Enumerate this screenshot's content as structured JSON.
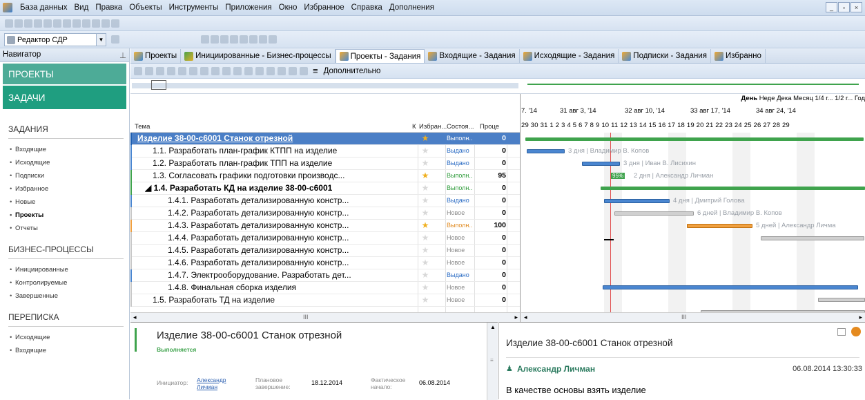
{
  "menu": [
    "База данных",
    "Вид",
    "Правка",
    "Объекты",
    "Инструменты",
    "Приложения",
    "Окно",
    "Избранное",
    "Справка",
    "Дополнения"
  ],
  "window_buttons": [
    "_",
    "▫",
    "×"
  ],
  "editor": {
    "label": "Редактор СДР"
  },
  "navigator": {
    "title": "Навигатор",
    "pin": "⊥",
    "big_items": [
      "ПРОЕКТЫ",
      "ЗАДАЧИ"
    ],
    "sections": [
      {
        "title": "ЗАДАНИЯ",
        "items": [
          "Входящие",
          "Исходящие",
          "Подписки",
          "Избранное",
          "Новые",
          "Проекты",
          "Отчеты"
        ],
        "bold_index": 5
      },
      {
        "title": "БИЗНЕС-ПРОЦЕССЫ",
        "items": [
          "Инициированные",
          "Контролируемые",
          "Завершенные"
        ]
      },
      {
        "title": "ПЕРЕПИСКА",
        "items": [
          "Исходящие",
          "Входящие"
        ]
      }
    ]
  },
  "tabs": [
    {
      "label": "Проекты",
      "icon": "projects-icon"
    },
    {
      "label": "Инициированные - Бизнес-процессы",
      "icon": "business-process-icon"
    },
    {
      "label": "Проекты - Задания",
      "icon": "tasks-icon",
      "selected": true
    },
    {
      "label": "Входящие - Задания",
      "icon": "tasks-icon"
    },
    {
      "label": "Исходящие - Задания",
      "icon": "tasks-icon"
    },
    {
      "label": "Подписки - Задания",
      "icon": "tasks-icon"
    },
    {
      "label": "Избранно",
      "icon": "tasks-icon"
    }
  ],
  "toolbar3": {
    "more_label": "Дополнительно",
    "more_icon": "hamburger-icon"
  },
  "grid": {
    "headers": {
      "topic": "Тема",
      "k": "К",
      "fav": "Избран...",
      "status": "Состоя...",
      "progress": "Проце"
    },
    "rows": [
      {
        "indent": 0,
        "text": "Изделие 38-00-с6001 Станок отрезной",
        "bold": true,
        "selected": true,
        "fav": true,
        "status": "Выполн...",
        "status_color": "white",
        "progress": "0",
        "bar": "#1f5fb0"
      },
      {
        "indent": 1,
        "text": "1.1. Разработать план-график КТПП на изделие",
        "bold": false,
        "fav": false,
        "status": "Выдано",
        "status_color": "blue",
        "progress": "0",
        "bar": "#4a86d0"
      },
      {
        "indent": 1,
        "text": "1.2. Разработать план-график ТПП на изделие",
        "bold": false,
        "fav": false,
        "status": "Выдано",
        "status_color": "blue",
        "progress": "0",
        "bar": "#4a86d0"
      },
      {
        "indent": 1,
        "text": "1.3. Согласовать графики подготовки производс...",
        "bold": false,
        "fav": true,
        "status": "Выполн...",
        "status_color": "green",
        "progress": "95",
        "bar": "#3fa34d"
      },
      {
        "indent": 0.5,
        "text": "◢ 1.4. Разработать КД на изделие 38-00-с6001",
        "bold": true,
        "fav": false,
        "status": "Выполн...",
        "status_color": "green",
        "progress": "0",
        "bar": "#3fa34d"
      },
      {
        "indent": 2,
        "text": "1.4.1. Разработать детализированную констр...",
        "bold": false,
        "fav": false,
        "status": "Выдано",
        "status_color": "blue",
        "progress": "0",
        "bar": "#4a86d0"
      },
      {
        "indent": 2,
        "text": "1.4.2. Разработать детализированную констр...",
        "bold": false,
        "fav": false,
        "status": "Новое",
        "status_color": "gray",
        "progress": "0",
        "bar": "#c8c8c8"
      },
      {
        "indent": 2,
        "text": "1.4.3. Разработать детализированную констр...",
        "bold": false,
        "fav": true,
        "status": "Выполн...",
        "status_color": "orange",
        "progress": "100",
        "bar": "#f0a040"
      },
      {
        "indent": 2,
        "text": "1.4.4. Разработать детализированную констр...",
        "bold": false,
        "fav": false,
        "status": "Новое",
        "status_color": "gray",
        "progress": "0",
        "bar": "#c8c8c8"
      },
      {
        "indent": 2,
        "text": "1.4.5. Разработать детализированную констр...",
        "bold": false,
        "fav": false,
        "status": "Новое",
        "status_color": "gray",
        "progress": "0",
        "bar": "#c8c8c8"
      },
      {
        "indent": 2,
        "text": "1.4.6. Разработать детализированную констр...",
        "bold": false,
        "fav": false,
        "status": "Новое",
        "status_color": "gray",
        "progress": "0",
        "bar": "#c8c8c8"
      },
      {
        "indent": 2,
        "text": "1.4.7. Электрооборудование. Разработать дет...",
        "bold": false,
        "fav": false,
        "status": "Выдано",
        "status_color": "blue",
        "progress": "0",
        "bar": "#4a86d0"
      },
      {
        "indent": 2,
        "text": "1.4.8. Финальная сборка изделия",
        "bold": false,
        "fav": false,
        "status": "Новое",
        "status_color": "gray",
        "progress": "0",
        "bar": "#c8c8c8"
      },
      {
        "indent": 1,
        "text": "1.5. Разработать ТД на изделие",
        "bold": false,
        "fav": false,
        "status": "Новое",
        "status_color": "gray",
        "progress": "0",
        "bar": "#c8c8c8"
      }
    ]
  },
  "gantt": {
    "view_switch": [
      "День",
      "Неде",
      "Дека",
      "Месяц",
      "1/4 г...",
      "1/2 г...",
      "Год"
    ],
    "weeks": [
      "7. '14",
      "31 авг 3, '14",
      "32 авг 10, '14",
      "33 авг 17, '14",
      "34 авг 24, '14"
    ],
    "days": "29 30 31  1  2  3  4  5  6  7  8  9 10 11 12 13 14 15 16 17 18 19 20 21 22 23 24 25 26 27 28 29",
    "labels": [
      "3 дня | Владимир В. Копов",
      "3 дня | Иван В. Лисихин",
      "95%",
      "2 дня | Александр Личман",
      "4 дня | Дмитрий Голова",
      "6 дней | Владимир В. Копов",
      "5 дней | Александр Личма"
    ],
    "scroll_thumb": "III"
  },
  "detail_left": {
    "title": "Изделие 38-00-с6001 Станок отрезной",
    "status": "Выполняется",
    "initiator_label": "Инициатор:",
    "initiator": "Александр Личман",
    "planned_label": "Плановое завершение:",
    "planned_value": "18.12.2014",
    "actual_label": "Фактическое начало:",
    "actual_value": "06.08.2014"
  },
  "detail_right": {
    "title": "Изделие 38-00-с6001 Станок отрезной",
    "author": "Александр Личман",
    "timestamp": "06.08.2014 13:30:33",
    "text": "В качестве основы взять изделие"
  },
  "colors": {
    "accent_teal": "#1f9e80",
    "accent_teal_light": "#4dab97",
    "selection": "#4b7fc6",
    "today_line": "#e05050"
  }
}
